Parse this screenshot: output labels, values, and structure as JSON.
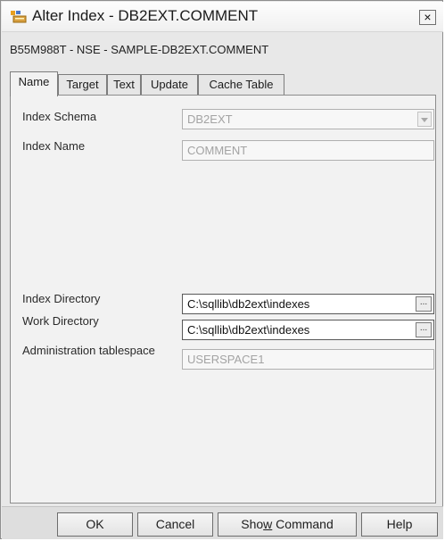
{
  "window": {
    "title": "Alter Index - DB2EXT.COMMENT",
    "close_label": "×"
  },
  "subtitle": "B55M988T - NSE - SAMPLE-DB2EXT.COMMENT",
  "tabs": [
    {
      "label": "Name",
      "active": true
    },
    {
      "label": "Target",
      "active": false
    },
    {
      "label": "Text",
      "active": false
    },
    {
      "label": "Update",
      "active": false
    },
    {
      "label": "Cache Table",
      "active": false
    }
  ],
  "fields": {
    "index_schema": {
      "label": "Index Schema",
      "value": "DB2EXT"
    },
    "index_name": {
      "label": "Index Name",
      "value": "COMMENT"
    },
    "index_directory": {
      "label": "Index Directory",
      "value": "C:\\sqllib\\db2ext\\indexes"
    },
    "work_directory": {
      "label": "Work Directory",
      "value": "C:\\sqllib\\db2ext\\indexes"
    },
    "admin_tablespace": {
      "label": "Administration tablespace",
      "value": "USERSPACE1"
    }
  },
  "browse_label": "...",
  "buttons": {
    "ok": "OK",
    "cancel": "Cancel",
    "show_command_pre": "Sho",
    "show_command_accel": "w",
    "show_command_post": " Command",
    "help": "Help"
  }
}
